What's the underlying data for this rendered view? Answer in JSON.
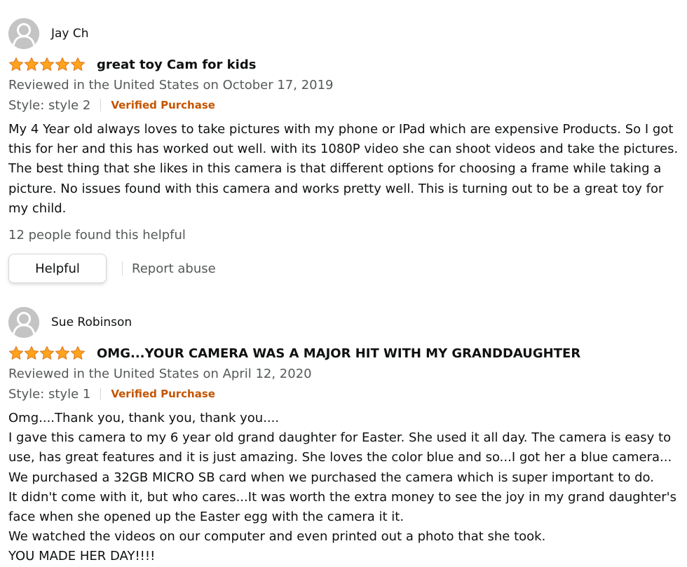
{
  "colors": {
    "star": "#ffa41c",
    "star_outline": "#de7921",
    "verified": "#c45500",
    "muted_text": "#565959",
    "text": "#0f1111"
  },
  "reviews": [
    {
      "reviewer": "Jay Ch",
      "avatar_icon": "person-silhouette-icon",
      "rating": 5,
      "title": "great toy Cam for kids",
      "date": "Reviewed in the United States on October 17, 2019",
      "style": "Style: style 2",
      "verified": "Verified Purchase",
      "body": [
        "My 4 Year old always loves to take pictures with my phone or IPad which are expensive Products. So I got this for her and this has worked out well. with its 1080P video she can shoot videos and take the pictures. The best thing that she likes in this camera is that different options for choosing a frame while taking a picture. No issues found with this camera and works pretty well. This is turning out to be a great toy for my child."
      ],
      "helpful_count": "12 people found this helpful",
      "helpful_label": "Helpful",
      "report_label": "Report abuse"
    },
    {
      "reviewer": "Sue Robinson",
      "avatar_icon": "person-silhouette-icon",
      "rating": 5,
      "title": "OMG...YOUR CAMERA WAS A MAJOR HIT WITH MY GRANDDAUGHTER",
      "date": "Reviewed in the United States on April 12, 2020",
      "style": "Style: style 1",
      "verified": "Verified Purchase",
      "body": [
        "Omg....Thank you, thank you, thank you....",
        "I gave this camera to my 6 year old grand daughter for Easter. She used it all day. The camera is easy to use, has great features and it is just amazing. She loves the color blue and so...I got her a blue camera...",
        "We purchased a 32GB MICRO SB card when we purchased the camera which is super important to do.",
        "It didn't come with it, but who cares...It was worth the extra money to see the joy in my grand daughter's face when she opened up the Easter egg with the camera it it.",
        "We watched the videos on our computer and even printed out a photo that she took.",
        "YOU MADE HER DAY!!!!"
      ]
    }
  ]
}
